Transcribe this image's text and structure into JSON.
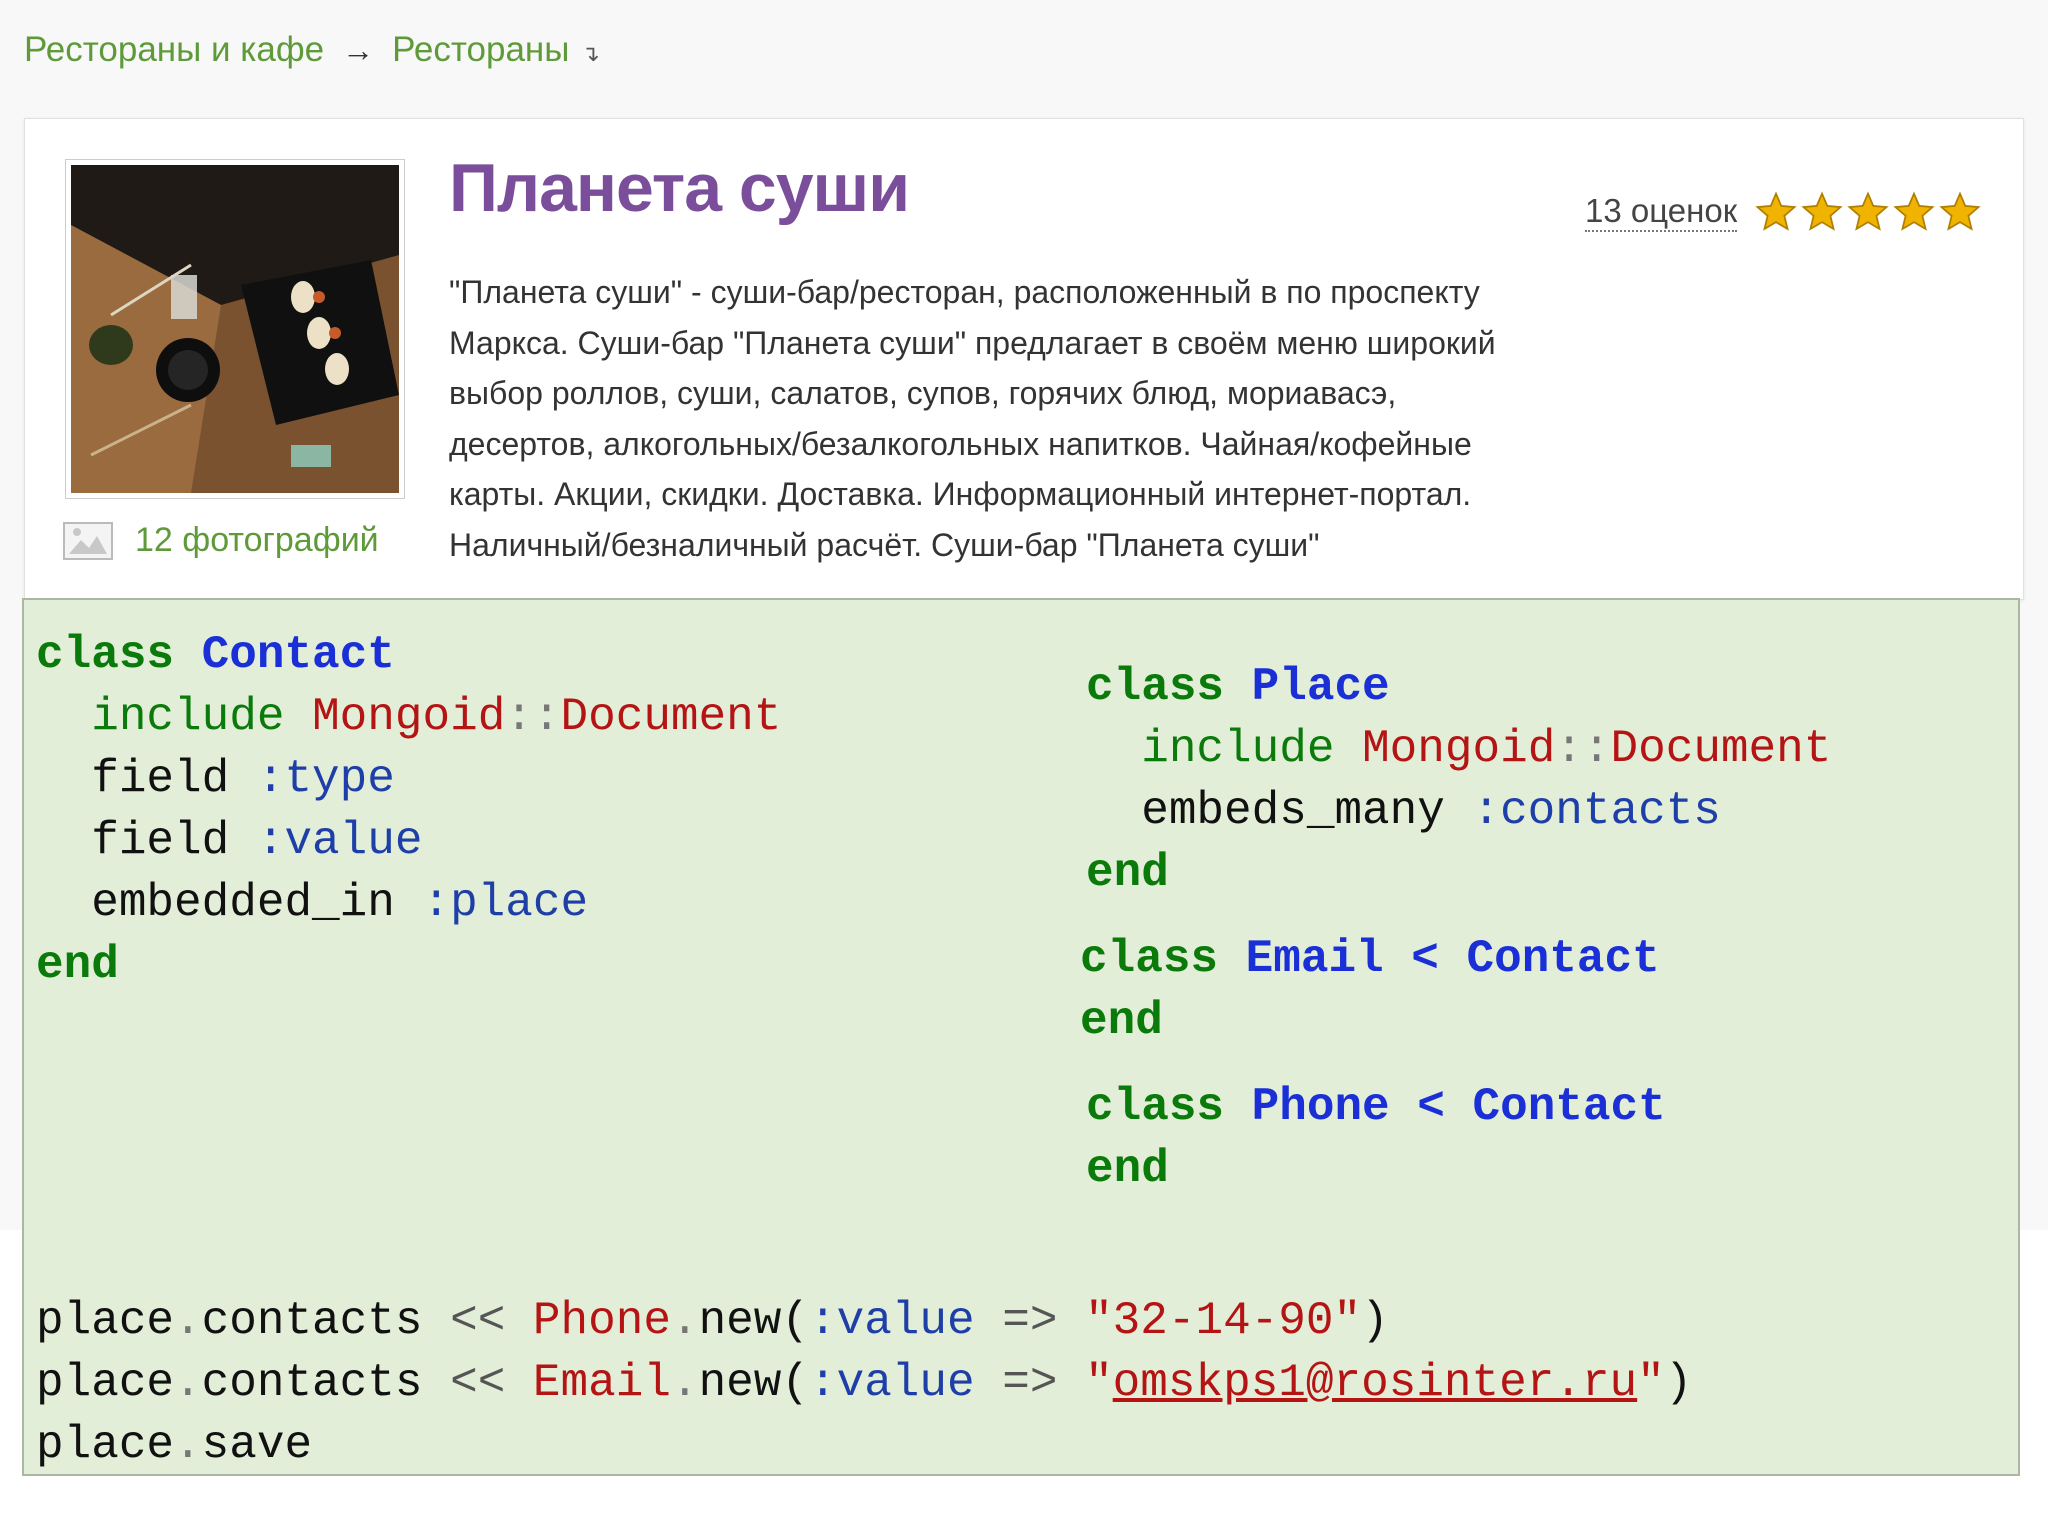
{
  "breadcrumb": {
    "level1": "Рестораны и кафе",
    "separator": "→",
    "level2": "Рестораны"
  },
  "place": {
    "title": "Планета суши",
    "description": "\"Планета суши\" - суши-бар/ресторан, расположенный в по проспекту Маркса. Суши-бар \"Планета суши\" предлагает в своём меню широкий выбор роллов, суши, салатов, супов, горячих блюд, мориавасэ, десертов, алкогольных/безалкогольных напитков. Чайная/кофейные карты. Акции, скидки. Доставка. Информационный интернет-портал. Наличный/безналичный расчёт. Суши-бар \"Планета суши\"",
    "photos_label": "12 фотографий",
    "rating_count": "13 оценок",
    "rating_stars": 5
  },
  "code": {
    "contact_class": [
      "class Contact",
      "include Mongoid::Document",
      "field :type",
      "field :value",
      "embedded_in :place",
      "end"
    ],
    "place_class": [
      "class Place",
      "include Mongoid::Document",
      "embeds_many :contacts",
      "end"
    ],
    "email_class": [
      "class Email < Contact",
      "end"
    ],
    "phone_class": [
      "class Phone < Contact",
      "end"
    ],
    "usage": [
      "place.contacts << Phone.new(:value => \"32-14-90\")",
      "place.contacts << Email.new(:value => \"omskps1@rosinter.ru\")",
      "place.save"
    ]
  },
  "colors": {
    "breadcrumb_link": "#5f9a3a",
    "title": "#7a4e9a",
    "code_background": "#e3eed9",
    "keyword": "#0a7a0a",
    "class_name": "#1a2fd6",
    "constant": "#b41414",
    "star": "#f0b400"
  },
  "icons": [
    "image-icon",
    "star-icon",
    "dropdown-arrow-icon"
  ]
}
